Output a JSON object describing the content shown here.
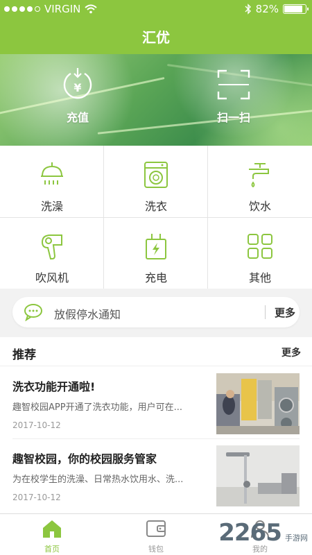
{
  "status_bar": {
    "carrier": "VIRGIN",
    "battery": "82%",
    "signal_dots_filled": 4,
    "signal_dots_total": 5
  },
  "header": {
    "title": "汇优"
  },
  "banner": {
    "recharge_label": "充值",
    "recharge_symbol": "¥",
    "scan_label": "扫一扫"
  },
  "services": [
    {
      "label": "洗澡",
      "icon": "shower-icon"
    },
    {
      "label": "洗衣",
      "icon": "washing-machine-icon"
    },
    {
      "label": "饮水",
      "icon": "faucet-icon"
    },
    {
      "label": "吹风机",
      "icon": "hair-dryer-icon"
    },
    {
      "label": "充电",
      "icon": "charger-icon"
    },
    {
      "label": "其他",
      "icon": "grid-icon"
    }
  ],
  "notice": {
    "text": "放假停水通知",
    "more": "更多"
  },
  "recommend": {
    "title": "推荐",
    "more": "更多",
    "items": [
      {
        "title": "洗衣功能开通啦!",
        "desc": "趣智校园APP开通了洗衣功能，用户可在...",
        "date": "2017-10-12"
      },
      {
        "title": "趣智校园，你的校园服务管家",
        "desc": "为在校学生的洗澡、日常热水饮用水、洗...",
        "date": "2017-10-12"
      }
    ]
  },
  "tabbar": [
    {
      "label": "首页",
      "active": true
    },
    {
      "label": "钱包",
      "active": false
    },
    {
      "label": "我的",
      "active": false
    }
  ],
  "watermark": {
    "text": "2265",
    "sub": "手游网"
  },
  "colors": {
    "brand": "#8cc63f",
    "text": "#333333",
    "muted": "#999999"
  }
}
